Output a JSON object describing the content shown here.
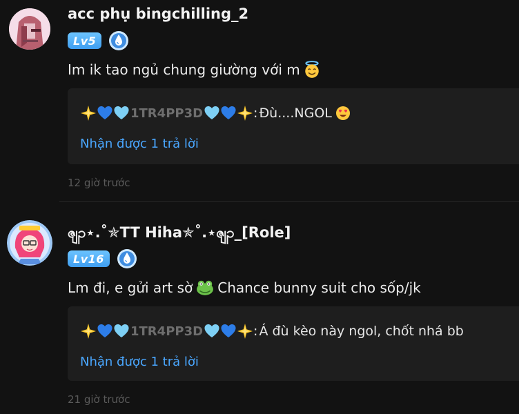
{
  "comments": [
    {
      "username": "acc phụ bingchilling_2",
      "level": "Lv5",
      "text": "Im ik tao ngủ chung giường với m",
      "text_emoji_icon": "smiling-face-with-halo-icon",
      "reply": {
        "author": "1TR4PP3D",
        "separator": ":",
        "text": "Đù....NGOL",
        "text_emoji_icon": "heart-eyes-icon"
      },
      "reply_link": "Nhận được 1 trả lời",
      "timestamp": "12 giờ trước"
    },
    {
      "username": "ၛၣ⋆.˚✯TT Hiha✯˚.⋆ၛၣ_[Role]",
      "level": "Lv16",
      "text_before": "Lm đi, e gửi art sờ",
      "text_emoji_icon": "frog-face-icon",
      "text_after": "Chance bunny suit cho sốp/jk",
      "reply": {
        "author": "1TR4PP3D",
        "separator": ":",
        "text": "Á đù kèo này ngol, chốt nhá bb"
      },
      "reply_link": "Nhận được 1 trả lời",
      "timestamp": "21 giờ trước"
    }
  ],
  "colors": {
    "background": "#121212",
    "reply_box": "#1e1e1e",
    "link": "#4aa7ff",
    "level_badge": "#4aa7f5",
    "timestamp": "#5a5a5a"
  }
}
